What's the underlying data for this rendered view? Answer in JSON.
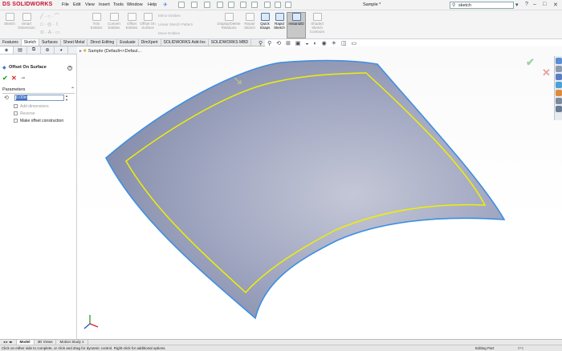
{
  "app": {
    "brand": "SOLIDWORKS",
    "brand_prefix": "DS"
  },
  "menu": [
    "File",
    "Edit",
    "View",
    "Insert",
    "Tools",
    "Window",
    "Help"
  ],
  "document_title": "Sample *",
  "search": {
    "value": "sketch"
  },
  "help_icon": "?",
  "command_manager": {
    "buttons": [
      "Sketch",
      "Smart Dimension",
      "Trim Entities",
      "Convert Entities",
      "Offset Entities",
      "Offset On Surface",
      "Mirror Entities",
      "Linear Sketch Pattern",
      "Move Entities",
      "Display/Delete Relations",
      "Repair Sketch",
      "Quick Snaps",
      "Rapid Sketch",
      "Instant2D",
      "Shaded Sketch Contours"
    ]
  },
  "tabs": [
    "Features",
    "Sketch",
    "Surfaces",
    "Sheet Metal",
    "Direct Editing",
    "Evaluate",
    "DimXpert",
    "SOLIDWORKS Add-Ins",
    "SOLIDWORKS MBD"
  ],
  "active_tab": "Sketch",
  "property_manager": {
    "title": "Offset On Surface",
    "section": "Parameters",
    "distance_value": "0.00in",
    "options": [
      "Add dimensions",
      "Reverse",
      "Make offset construction"
    ]
  },
  "feature_tree": {
    "item": "Sample  (Default<<Defaul..."
  },
  "model_tabs": [
    "Model",
    "3D Views",
    "Motion Study 1"
  ],
  "status": {
    "message": "Click on either side to complete, or click and drag for dynamic control.  Right-click for additional options.",
    "mode": "Editing Part",
    "units": "IPS"
  },
  "colors": {
    "surface": "#a6acc8",
    "edge": "#3d8fe0",
    "sketch": "#f0f000",
    "brand": "#c8102e"
  }
}
